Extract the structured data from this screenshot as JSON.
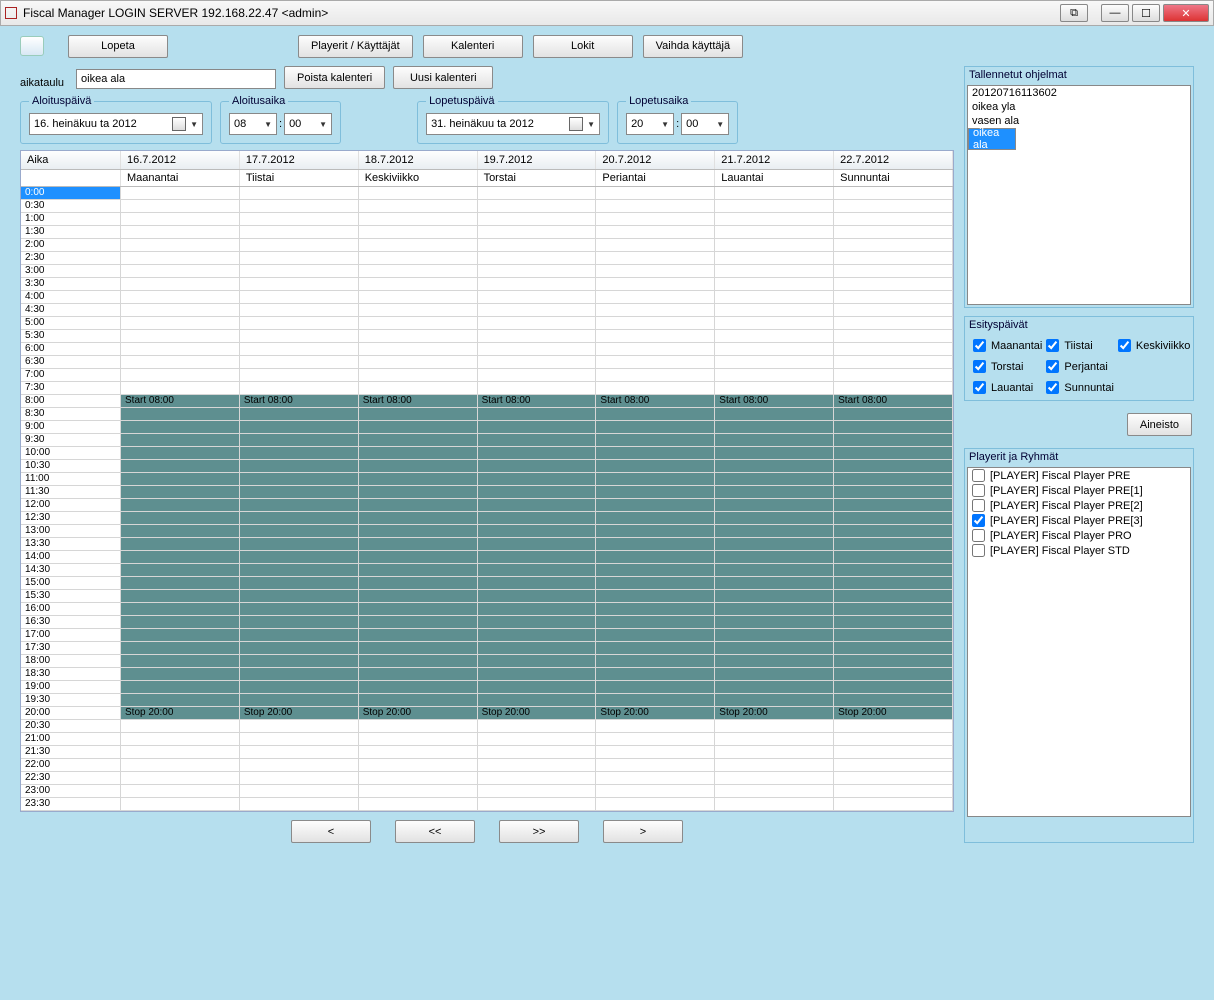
{
  "window": {
    "title": "Fiscal Manager LOGIN SERVER 192.168.22.47 <admin>"
  },
  "toolbar": {
    "quit": "Lopeta",
    "players": "Playerit / Käyttäjät",
    "calendar": "Kalenteri",
    "logs": "Lokit",
    "switch_user": "Vaihda käyttäjä"
  },
  "schedule": {
    "label": "aikataulu",
    "name": "oikea ala",
    "delete_cal": "Poista kalenteri",
    "new_cal": "Uusi kalenteri",
    "start_day_legend": "Aloituspäivä",
    "start_day": "16. heinäkuu ta 2012",
    "start_time_legend": "Aloitusaika",
    "start_hh": "08",
    "start_mm": "00",
    "end_day_legend": "Lopetuspäivä",
    "end_day": "31. heinäkuu ta 2012",
    "end_time_legend": "Lopetusaika",
    "end_hh": "20",
    "end_mm": "00"
  },
  "grid": {
    "time_header": "Aika",
    "dates": [
      "16.7.2012",
      "17.7.2012",
      "18.7.2012",
      "19.7.2012",
      "20.7.2012",
      "21.7.2012",
      "22.7.2012"
    ],
    "days": [
      "Maanantai",
      "Tiistai",
      "Keskiviikko",
      "Torstai",
      "Periantai",
      "Lauantai",
      "Sunnuntai"
    ],
    "times": [
      "0:00",
      "0:30",
      "1:00",
      "1:30",
      "2:00",
      "2:30",
      "3:00",
      "3:30",
      "4:00",
      "4:30",
      "5:00",
      "5:30",
      "6:00",
      "6:30",
      "7:00",
      "7:30",
      "8:00",
      "8:30",
      "9:00",
      "9:30",
      "10:00",
      "10:30",
      "11:00",
      "11:30",
      "12:00",
      "12:30",
      "13:00",
      "13:30",
      "14:00",
      "14:30",
      "15:00",
      "15:30",
      "16:00",
      "16:30",
      "17:00",
      "17:30",
      "18:00",
      "18:30",
      "19:00",
      "19:30",
      "20:00",
      "20:30",
      "21:00",
      "21:30",
      "22:00",
      "22:30",
      "23:00",
      "23:30"
    ],
    "start_label": "Start 08:00",
    "stop_label": "Stop 20:00",
    "start_idx": 16,
    "stop_idx": 40
  },
  "nav": {
    "prev": "<",
    "first": "<<",
    "last": ">>",
    "next": ">"
  },
  "saved": {
    "title": "Tallennetut ohjelmat",
    "items": [
      "20120716113602",
      "oikea yla",
      "vasen ala",
      "oikea ala"
    ],
    "selected": 3
  },
  "daysbox": {
    "title": "Esityspäivät",
    "items": [
      {
        "label": "Maanantai",
        "checked": true
      },
      {
        "label": "Tiistai",
        "checked": true
      },
      {
        "label": "Keskiviikko",
        "checked": true
      },
      {
        "label": "Torstai",
        "checked": true
      },
      {
        "label": "Perjantai",
        "checked": true
      },
      {
        "label": "",
        "checked": false,
        "blank": true
      },
      {
        "label": "Lauantai",
        "checked": true
      },
      {
        "label": "Sunnuntai",
        "checked": true
      }
    ]
  },
  "aineisto": "Aineisto",
  "players": {
    "title": "Playerit ja Ryhmät",
    "items": [
      {
        "label": "[PLAYER] Fiscal Player PRE",
        "checked": false
      },
      {
        "label": "[PLAYER] Fiscal Player PRE[1]",
        "checked": false
      },
      {
        "label": "[PLAYER] Fiscal Player PRE[2]",
        "checked": false
      },
      {
        "label": "[PLAYER] Fiscal Player PRE[3]",
        "checked": true
      },
      {
        "label": "[PLAYER] Fiscal Player PRO",
        "checked": false
      },
      {
        "label": "[PLAYER] Fiscal Player STD",
        "checked": false
      }
    ]
  }
}
